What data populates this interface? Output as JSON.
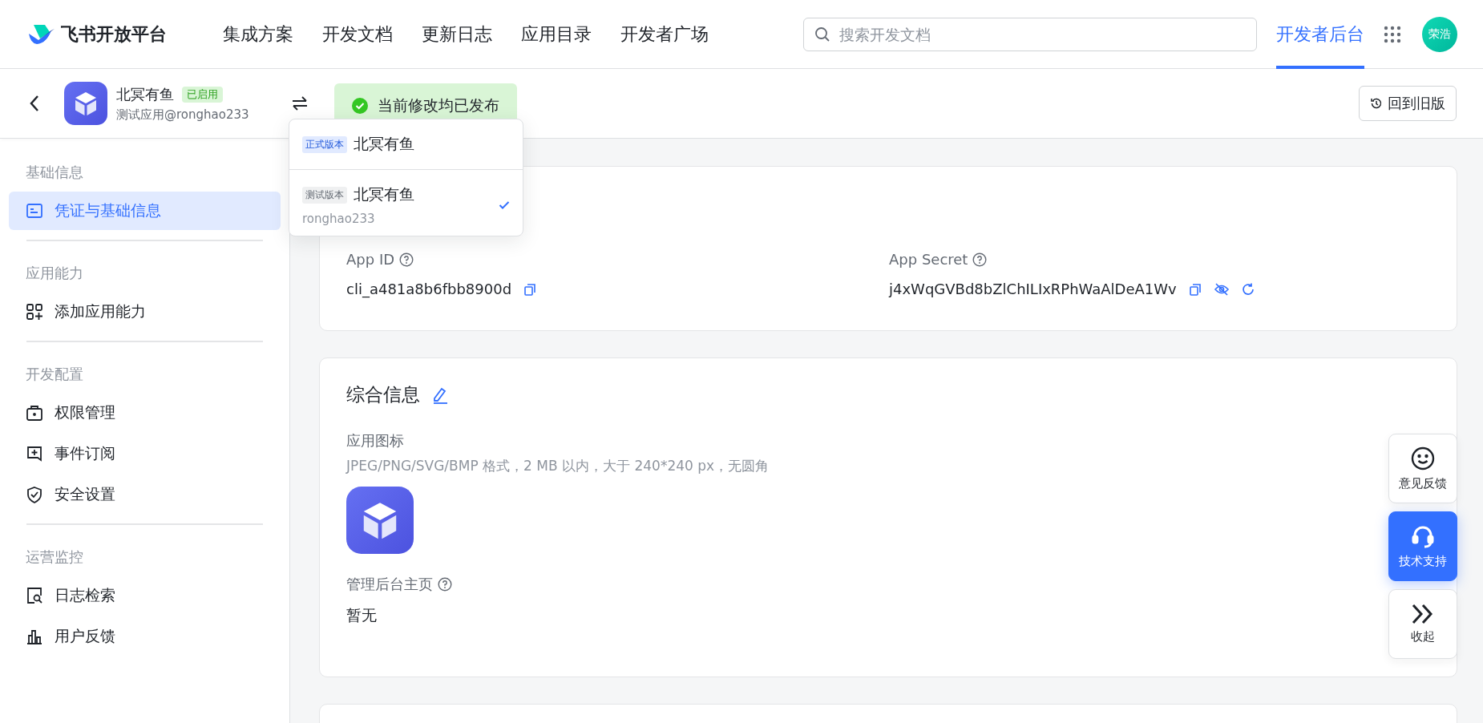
{
  "header": {
    "logo": "飞书开放平台",
    "nav": [
      {
        "label": "集成方案",
        "selected": false
      },
      {
        "label": "开发文档",
        "selected": false
      },
      {
        "label": "更新日志",
        "selected": false
      },
      {
        "label": "应用目录",
        "selected": false
      },
      {
        "label": "开发者广场",
        "selected": false
      }
    ],
    "search": {
      "placeholder": "搜索开发文档"
    },
    "console_tab": {
      "label": "开发者后台",
      "selected": true
    },
    "avatar": "荣浩"
  },
  "app_bar": {
    "app_name": "北冥有鱼",
    "status_badge": "已启用",
    "subtitle": "测试应用@ronghao233",
    "publish_status": "当前修改均已发布",
    "old_version_button": "回到旧版"
  },
  "version_menu": [
    {
      "kind": "release",
      "tag": "正式版本",
      "name": "北冥有鱼",
      "selected": false
    },
    {
      "kind": "test",
      "tag": "测试版本",
      "name": "北冥有鱼",
      "owner": "ronghao233",
      "selected": true
    }
  ],
  "sidebar": [
    {
      "title": "基础信息",
      "items": [
        {
          "label": "凭证与基础信息",
          "selected": true
        }
      ]
    },
    {
      "title": "应用能力",
      "items": [
        {
          "label": "添加应用能力",
          "selected": false
        }
      ]
    },
    {
      "title": "开发配置",
      "items": [
        {
          "label": "权限管理",
          "selected": false
        },
        {
          "label": "事件订阅",
          "selected": false
        },
        {
          "label": "安全设置",
          "selected": false
        }
      ]
    },
    {
      "title": "运营监控",
      "items": [
        {
          "label": "日志检索",
          "selected": false
        },
        {
          "label": "用户反馈",
          "selected": false
        }
      ]
    }
  ],
  "credentials": [
    {
      "kind": "id",
      "label": "App ID",
      "value": "cli_a481a8b6fbb8900d"
    },
    {
      "kind": "secret",
      "label": "App Secret",
      "value": "j4xWqGVBd8bZlChILIxRPhWaAlDeA1Wv"
    }
  ],
  "general_info": {
    "title": "综合信息",
    "icon_label": "应用图标",
    "icon_hint": "JPEG/PNG/SVG/BMP 格式，2 MB 以内，大于 240*240 px，无圆角",
    "homepage_label": "管理后台主页",
    "homepage_value": "暂无"
  },
  "float_buttons": [
    {
      "kind": "feedback",
      "label": "意见反馈",
      "selected": false
    },
    {
      "kind": "support",
      "label": "技术支持",
      "selected": true
    },
    {
      "kind": "collapse",
      "label": "收起",
      "selected": false
    }
  ]
}
